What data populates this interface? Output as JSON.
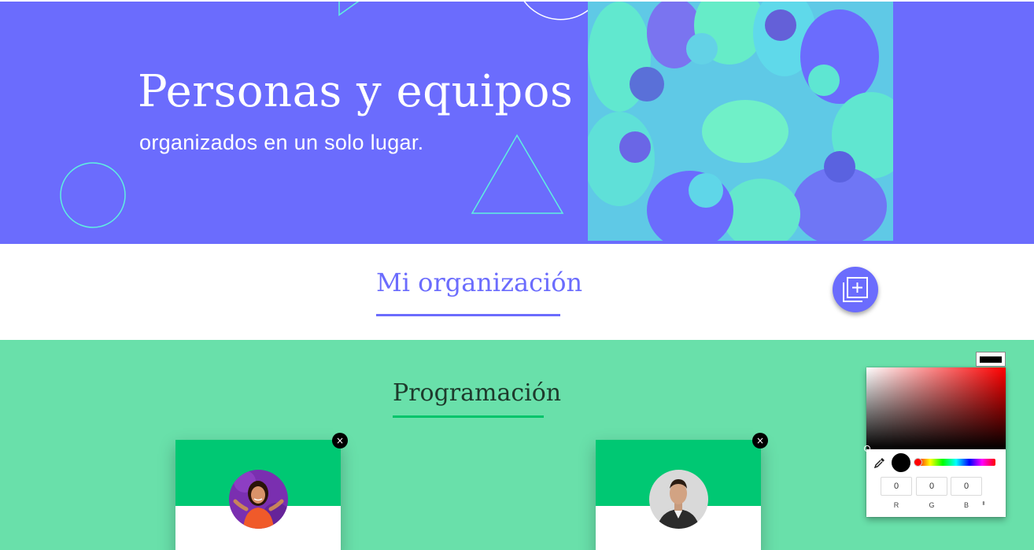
{
  "hero": {
    "title": "Personas y equipos",
    "subtitle": "organizados en un solo lugar."
  },
  "organization": {
    "title": "Mi organización",
    "add_button_icon": "add-copy-icon"
  },
  "schedule": {
    "title": "Programación",
    "cards": [
      {
        "avatar": "woman-avatar",
        "close_label": "×"
      },
      {
        "avatar": "man-avatar",
        "close_label": "×"
      }
    ]
  },
  "color_picker": {
    "current_color": "#000000",
    "hue_color": "#ff0000",
    "r": "0",
    "g": "0",
    "b": "0",
    "r_label": "R",
    "g_label": "G",
    "b_label": "B",
    "toggle_glyph": "⬍"
  },
  "colors": {
    "hero_bg": "#6b6cfd",
    "accent_green": "#00c873",
    "section_green": "#69e0aa",
    "outline_cyan": "#5ff0e0"
  }
}
